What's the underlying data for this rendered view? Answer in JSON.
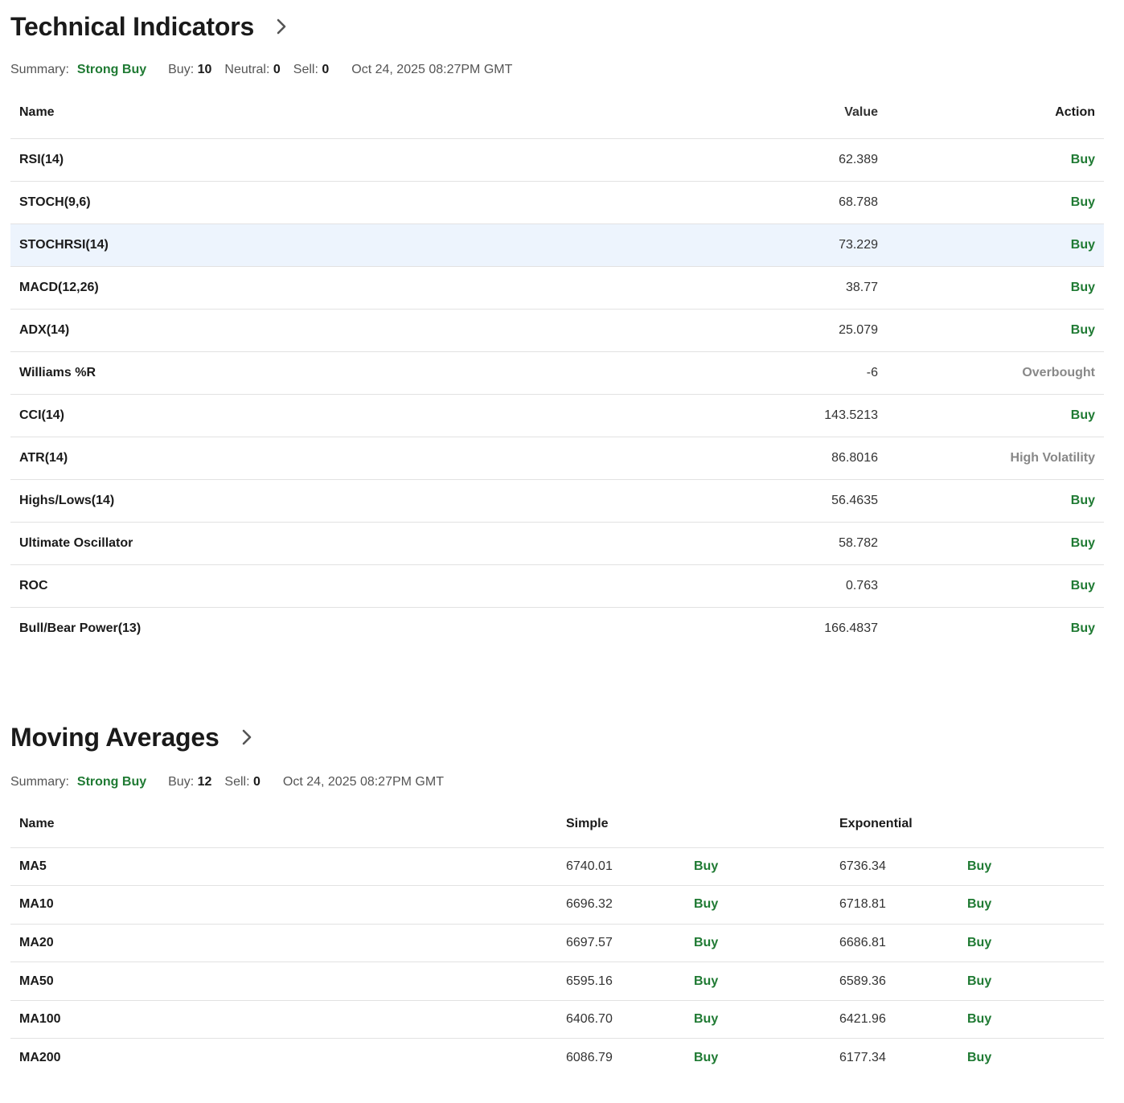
{
  "technical": {
    "title": "Technical Indicators",
    "summary": {
      "label": "Summary:",
      "verdict": "Strong Buy",
      "buy_label": "Buy:",
      "buy_count": "10",
      "neutral_label": "Neutral:",
      "neutral_count": "0",
      "sell_label": "Sell:",
      "sell_count": "0",
      "timestamp": "Oct 24, 2025 08:27PM GMT"
    },
    "columns": {
      "name": "Name",
      "value": "Value",
      "action": "Action"
    },
    "rows": [
      {
        "name": "RSI(14)",
        "value": "62.389",
        "action": "Buy"
      },
      {
        "name": "STOCH(9,6)",
        "value": "68.788",
        "action": "Buy"
      },
      {
        "name": "STOCHRSI(14)",
        "value": "73.229",
        "action": "Buy"
      },
      {
        "name": "MACD(12,26)",
        "value": "38.77",
        "action": "Buy"
      },
      {
        "name": "ADX(14)",
        "value": "25.079",
        "action": "Buy"
      },
      {
        "name": "Williams %R",
        "value": "-6",
        "action": "Overbought"
      },
      {
        "name": "CCI(14)",
        "value": "143.5213",
        "action": "Buy"
      },
      {
        "name": "ATR(14)",
        "value": "86.8016",
        "action": "High Volatility"
      },
      {
        "name": "Highs/Lows(14)",
        "value": "56.4635",
        "action": "Buy"
      },
      {
        "name": "Ultimate Oscillator",
        "value": "58.782",
        "action": "Buy"
      },
      {
        "name": "ROC",
        "value": "0.763",
        "action": "Buy"
      },
      {
        "name": "Bull/Bear Power(13)",
        "value": "166.4837",
        "action": "Buy"
      }
    ]
  },
  "moving": {
    "title": "Moving Averages",
    "summary": {
      "label": "Summary:",
      "verdict": "Strong Buy",
      "buy_label": "Buy:",
      "buy_count": "12",
      "sell_label": "Sell:",
      "sell_count": "0",
      "timestamp": "Oct 24, 2025 08:27PM GMT"
    },
    "columns": {
      "name": "Name",
      "simple": "Simple",
      "exponential": "Exponential"
    },
    "rows": [
      {
        "name": "MA5",
        "simple": "6740.01",
        "simple_action": "Buy",
        "exp": "6736.34",
        "exp_action": "Buy"
      },
      {
        "name": "MA10",
        "simple": "6696.32",
        "simple_action": "Buy",
        "exp": "6718.81",
        "exp_action": "Buy"
      },
      {
        "name": "MA20",
        "simple": "6697.57",
        "simple_action": "Buy",
        "exp": "6686.81",
        "exp_action": "Buy"
      },
      {
        "name": "MA50",
        "simple": "6595.16",
        "simple_action": "Buy",
        "exp": "6589.36",
        "exp_action": "Buy"
      },
      {
        "name": "MA100",
        "simple": "6406.70",
        "simple_action": "Buy",
        "exp": "6421.96",
        "exp_action": "Buy"
      },
      {
        "name": "MA200",
        "simple": "6086.79",
        "simple_action": "Buy",
        "exp": "6177.34",
        "exp_action": "Buy"
      }
    ]
  },
  "colors": {
    "buy": "#1f7a33",
    "neutral": "#888888",
    "highlight_row": "#edf4fd"
  },
  "icons": {
    "section_link": "chevron-right-icon"
  }
}
